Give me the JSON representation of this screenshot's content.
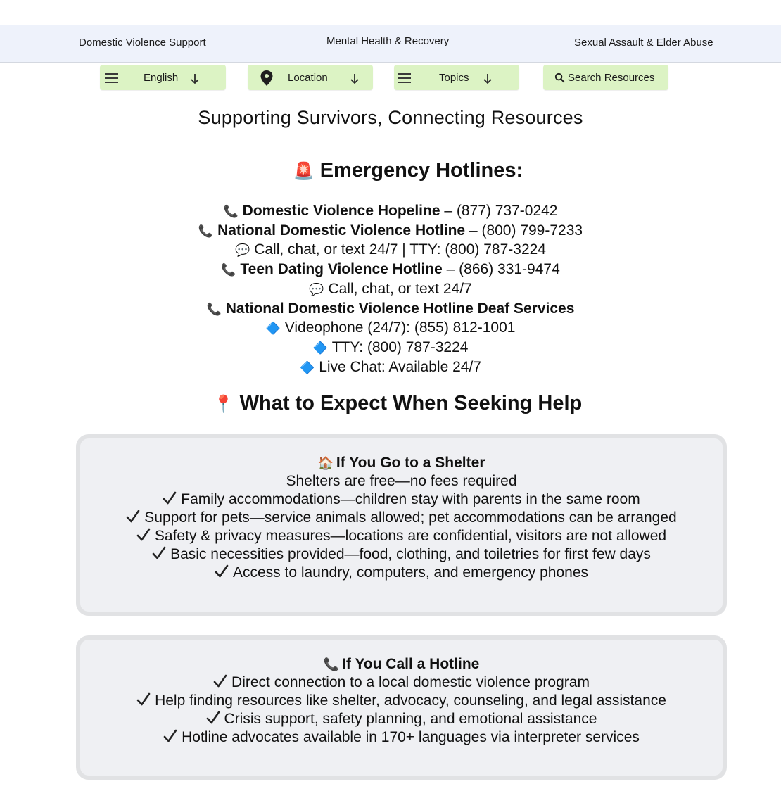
{
  "topnav": {
    "domestic_violence": "Domestic Violence Support",
    "mental_health": "Mental Health & Recovery",
    "sexual_assault": "Sexual Assault & Elder Abuse"
  },
  "toolbar": {
    "language": "English",
    "location": "Location",
    "topics": "Topics",
    "search": "Search Resources"
  },
  "tagline": "Supporting Survivors, Connecting Resources",
  "emergency": {
    "icon": "🚨",
    "heading": "Emergency Hotlines:",
    "hotlines": [
      {
        "icon": "📞",
        "name": "Domestic Violence Hopeline",
        "detail": " – (877) 737-0242"
      },
      {
        "icon": "📞",
        "name": "National Domestic Violence Hotline",
        "detail": " – (800) 799-7233"
      },
      {
        "icon": "💬",
        "name": "",
        "detail": "Call, chat, or text 24/7 | TTY: (800) 787-3224"
      },
      {
        "icon": "📞",
        "name": "Teen Dating Violence Hotline",
        "detail": " – (866) 331-9474"
      },
      {
        "icon": "💬",
        "name": "",
        "detail": "Call, chat, or text 24/7"
      },
      {
        "icon": "📞",
        "name": "National Domestic Violence Hotline Deaf Services",
        "detail": ""
      },
      {
        "icon": "🔷",
        "name": "",
        "detail": "Videophone (24/7): (855) 812-1001"
      },
      {
        "icon": "🔷",
        "name": "",
        "detail": "TTY: (800) 787-3224"
      },
      {
        "icon": "🔷",
        "name": "",
        "detail": "Live Chat: Available 24/7"
      }
    ]
  },
  "expect": {
    "icon": "📍",
    "heading": "What to Expect When Seeking Help"
  },
  "shelter": {
    "icon": "🏠",
    "title": "If You Go to a Shelter",
    "intro": "Shelters are free—no fees required",
    "items": [
      "Family accommodations—children stay with parents in the same room",
      "Support for pets—service animals allowed; pet accommodations can be arranged",
      "Safety & privacy measures—locations are confidential, visitors are not allowed",
      "Basic necessities provided—food, clothing, and toiletries for first few days",
      "Access to laundry, computers, and emergency phones"
    ]
  },
  "hotline": {
    "icon": "📞",
    "title": "If You Call a Hotline",
    "items": [
      "Direct connection to a local domestic violence program",
      "Help finding resources like shelter, advocacy, counseling, and legal assistance",
      "Crisis support, safety planning, and emotional assistance",
      "Hotline advocates available in 170+ languages via interpreter services"
    ]
  }
}
